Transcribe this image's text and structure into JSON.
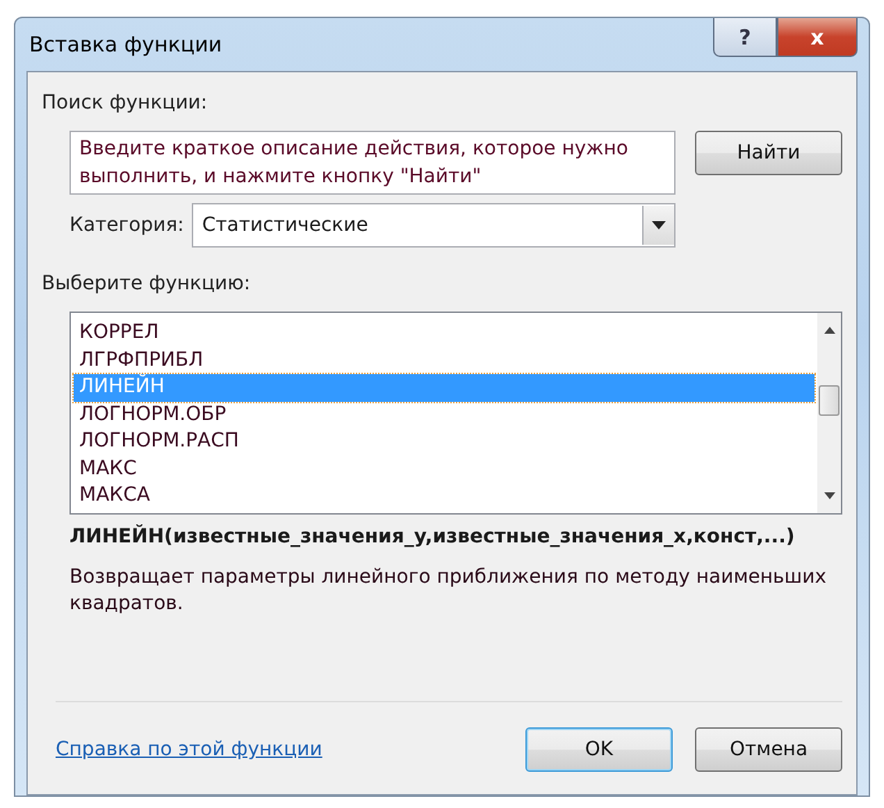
{
  "window": {
    "title": "Вставка функции",
    "help_button": "?",
    "close_button": "x"
  },
  "search": {
    "label": "Поиск функции:",
    "placeholder": "Введите краткое описание действия, которое нужно выполнить, и нажмите кнопку \"Найти\"",
    "button": "Найти"
  },
  "category": {
    "label": "Категория:",
    "value": "Статистические"
  },
  "function_list": {
    "label": "Выберите функцию:",
    "items": [
      {
        "name": "КОРРЕЛ",
        "selected": false
      },
      {
        "name": "ЛГРФПРИБЛ",
        "selected": false
      },
      {
        "name": "ЛИНЕЙН",
        "selected": true
      },
      {
        "name": "ЛОГНОРМ.ОБР",
        "selected": false
      },
      {
        "name": "ЛОГНОРМ.РАСП",
        "selected": false
      },
      {
        "name": "МАКС",
        "selected": false
      },
      {
        "name": "МАКСА",
        "selected": false
      }
    ]
  },
  "signature": "ЛИНЕЙН(известные_значения_y,известные_значения_x,конст,...)",
  "description": "Возвращает параметры линейного приближения по методу наименьших квадратов.",
  "help_link": "Справка по этой функции",
  "buttons": [
    {
      "label": "OK",
      "default": true
    },
    {
      "label": "Отмена",
      "default": false
    }
  ]
}
